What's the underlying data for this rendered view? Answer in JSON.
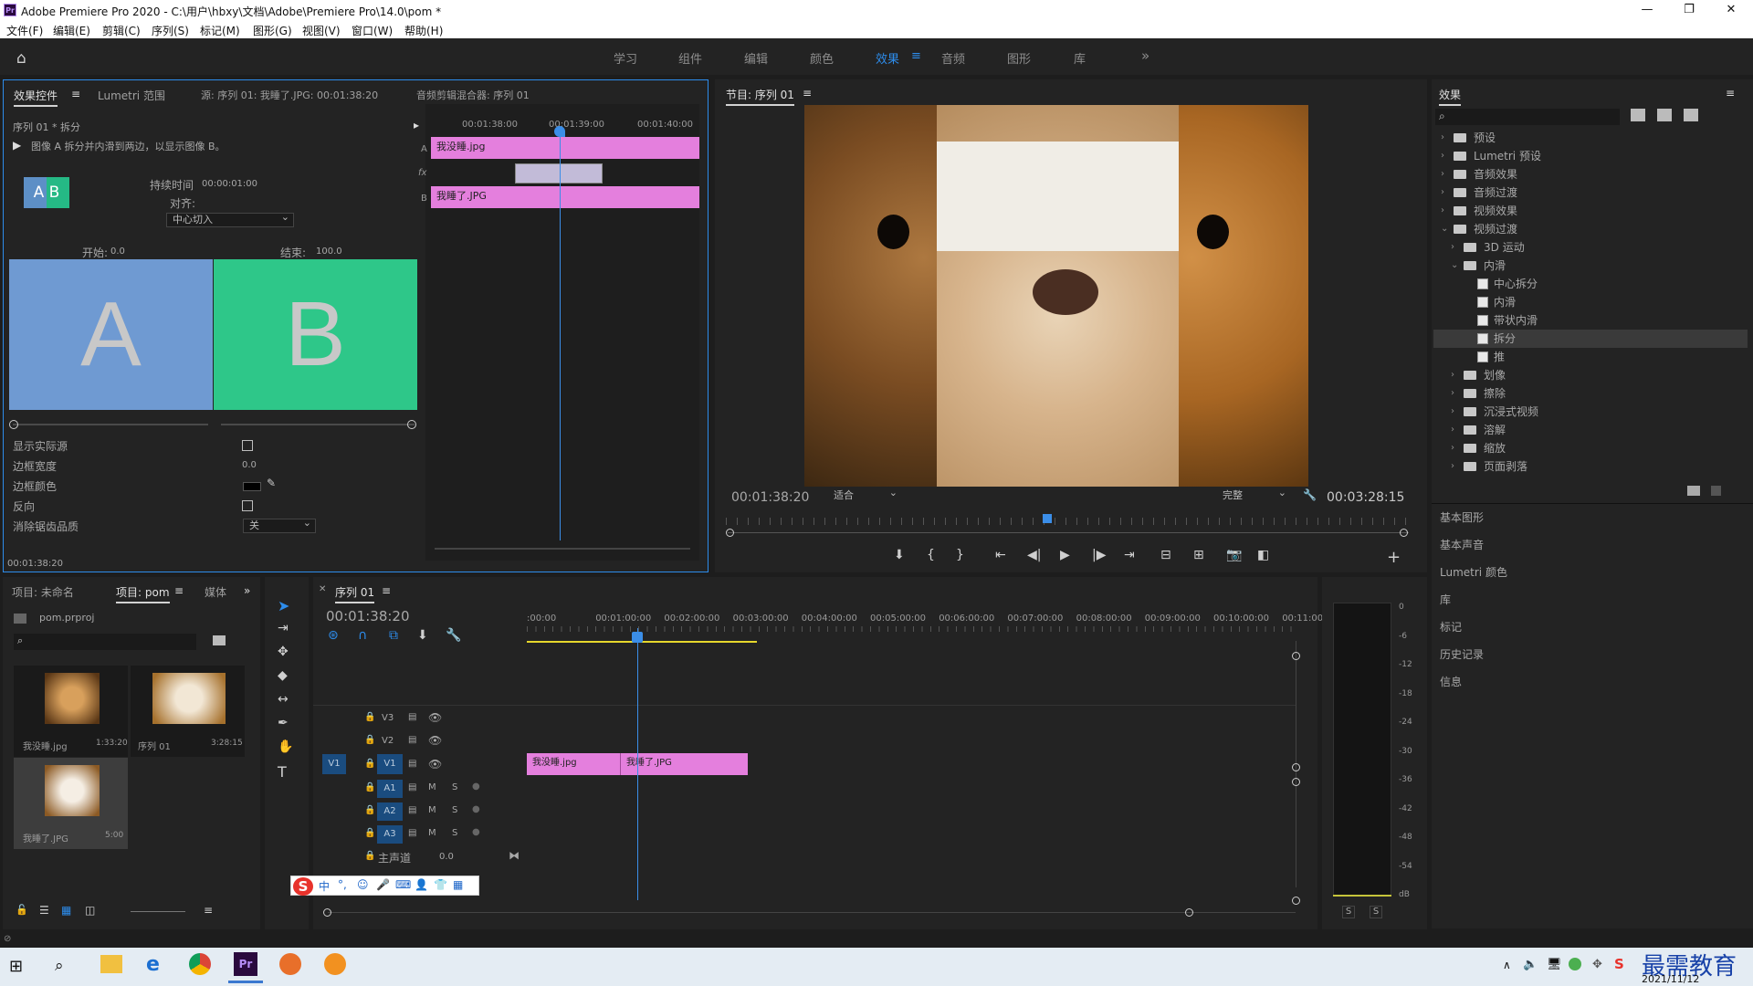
{
  "titlebar": {
    "title": "Adobe Premiere Pro 2020 - C:\\用户\\hbxy\\文档\\Adobe\\Premiere Pro\\14.0\\pom *",
    "app_badge": "Pr",
    "minimize": "—",
    "maximize": "❐",
    "close": "✕"
  },
  "menu": [
    "文件(F)",
    "编辑(E)",
    "剪辑(C)",
    "序列(S)",
    "标记(M)",
    "图形(G)",
    "视图(V)",
    "窗口(W)",
    "帮助(H)"
  ],
  "workspaces": {
    "items": [
      "学习",
      "组件",
      "编辑",
      "颜色",
      "效果",
      "音频",
      "图形",
      "库"
    ],
    "active": "效果",
    "more": "»",
    "home": "⌂"
  },
  "effect_controls": {
    "tabs": [
      "效果控件",
      "Lumetri 范围",
      "源: 序列 01: 我睡了.JPG: 00:01:38:20",
      "音频剪辑混合器: 序列 01"
    ],
    "sequence_path": "序列 01 * 拆分",
    "description": "图像 A 拆分并内滑到两边，以显示图像 B。",
    "thumb_label": "A B",
    "duration_label": "持续时间",
    "duration_value": "00:00:01:00",
    "align_label": "对齐:",
    "align_value": "中心切入",
    "start_label": "开始:",
    "start_value": "0.0",
    "end_label": "结束:",
    "end_value": "100.0",
    "preview_a": "A",
    "preview_b": "B",
    "color_a": "#6f9ad2",
    "color_b": "#2ec789",
    "show_source": "显示实际源",
    "border_width": "边框宽度",
    "border_width_value": "0.0",
    "border_color": "边框颜色",
    "reverse": "反向",
    "antialias": "消除锯齿品质",
    "antialias_value": "关",
    "timecode": "00:01:38:20",
    "mini_timeline": {
      "ticks": [
        "00:01:38:00",
        "00:01:39:00",
        "00:01:40:00"
      ],
      "clip_a": "我没睡.jpg",
      "clip_b": "我睡了.JPG",
      "track_a": "A",
      "track_b": "B",
      "fx": "fx"
    }
  },
  "program_monitor": {
    "title": "节目: 序列 01",
    "timecode": "00:01:38:20",
    "fit": "适合",
    "quality": "完整",
    "duration": "00:03:28:15"
  },
  "effects_panel": {
    "title": "效果",
    "search_placeholder": "",
    "tree": [
      {
        "label": "预设",
        "level": 0,
        "type": "folder",
        "expanded": false
      },
      {
        "label": "Lumetri 预设",
        "level": 0,
        "type": "folder",
        "expanded": false
      },
      {
        "label": "音频效果",
        "level": 0,
        "type": "folder",
        "expanded": false
      },
      {
        "label": "音频过渡",
        "level": 0,
        "type": "folder",
        "expanded": false
      },
      {
        "label": "视频效果",
        "level": 0,
        "type": "folder",
        "expanded": false
      },
      {
        "label": "视频过渡",
        "level": 0,
        "type": "folder",
        "expanded": true
      },
      {
        "label": "3D 运动",
        "level": 1,
        "type": "folder",
        "expanded": false
      },
      {
        "label": "内滑",
        "level": 1,
        "type": "folder",
        "expanded": true
      },
      {
        "label": "中心拆分",
        "level": 2,
        "type": "effect"
      },
      {
        "label": "内滑",
        "level": 2,
        "type": "effect"
      },
      {
        "label": "带状内滑",
        "level": 2,
        "type": "effect"
      },
      {
        "label": "拆分",
        "level": 2,
        "type": "effect",
        "selected": true
      },
      {
        "label": "推",
        "level": 2,
        "type": "effect"
      },
      {
        "label": "划像",
        "level": 1,
        "type": "folder",
        "expanded": false
      },
      {
        "label": "擦除",
        "level": 1,
        "type": "folder",
        "expanded": false
      },
      {
        "label": "沉浸式视频",
        "level": 1,
        "type": "folder",
        "expanded": false
      },
      {
        "label": "溶解",
        "level": 1,
        "type": "folder",
        "expanded": false
      },
      {
        "label": "缩放",
        "level": 1,
        "type": "folder",
        "expanded": false
      },
      {
        "label": "页面剥落",
        "level": 1,
        "type": "folder",
        "expanded": false
      }
    ],
    "sections": [
      "基本图形",
      "基本声音",
      "Lumetri 颜色",
      "库",
      "标记",
      "历史记录",
      "信息"
    ]
  },
  "project": {
    "tabs": [
      "项目: 未命名",
      "项目: pom",
      "媒体"
    ],
    "file": "pom.prproj",
    "items": [
      {
        "name": "我没睡.jpg",
        "dur": "1:33:20"
      },
      {
        "name": "序列 01",
        "dur": "3:28:15"
      },
      {
        "name": "我睡了.JPG",
        "dur": "5:00"
      }
    ]
  },
  "timeline": {
    "title": "序列 01",
    "timecode": "00:01:38:20",
    "ruler": [
      ":00:00",
      "00:01:00:00",
      "00:02:00:00",
      "00:03:00:00",
      "00:04:00:00",
      "00:05:00:00",
      "00:06:00:00",
      "00:07:00:00",
      "00:08:00:00",
      "00:09:00:00",
      "00:10:00:00",
      "00:11:00:"
    ],
    "video_tracks": [
      "V3",
      "V2",
      "V1"
    ],
    "audio_tracks": [
      "A1",
      "A2",
      "A3"
    ],
    "master": "主声道",
    "master_value": "0.0",
    "clip1": "我没睡.jpg",
    "clip2": "我睡了.JPG",
    "source_patch": "V1",
    "m": "M",
    "s": "S"
  },
  "meter": {
    "scale": [
      "0",
      "-6",
      "-12",
      "-18",
      "-24",
      "-30",
      "-36",
      "-42",
      "-48",
      "-54",
      "dB"
    ],
    "solo": [
      "S",
      "S"
    ]
  },
  "ime": [
    "中",
    "°,",
    "☺",
    "🎤",
    "⌨",
    "👤",
    "👕",
    "▦"
  ],
  "taskbar": {
    "date": "2021/11/12",
    "watermark": "最需教育"
  }
}
